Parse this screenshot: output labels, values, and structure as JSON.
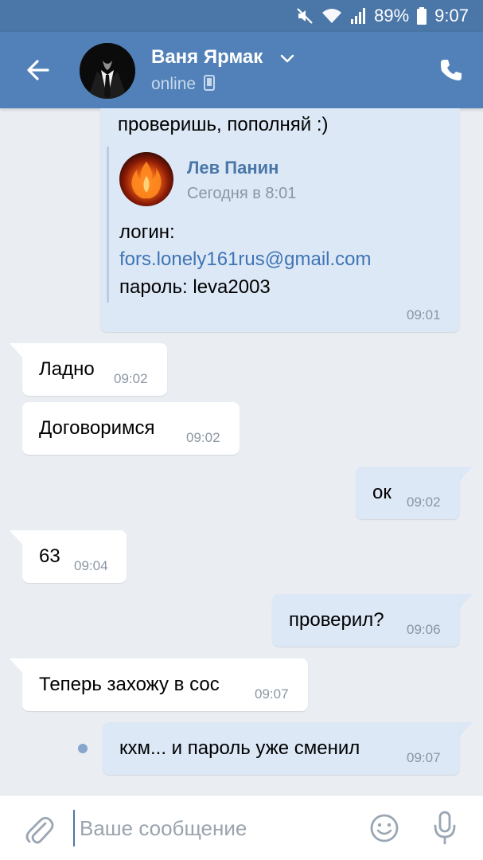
{
  "status_bar": {
    "battery_percent": "89%",
    "time": "9:07",
    "icons": [
      "mute-icon",
      "wifi-icon",
      "signal-icon",
      "battery-icon"
    ]
  },
  "header": {
    "contact_name": "Ваня Ярмак",
    "presence": "online",
    "icons": [
      "back-arrow-icon",
      "chevron-down-icon",
      "mobile-device-icon",
      "phone-icon"
    ]
  },
  "forwarded_message": {
    "text_top": "проверишь, пополняй :)",
    "author": "Лев Панин",
    "date": "Сегодня в 8:01",
    "line1": "логин:",
    "email": "fors.lonely161rus@gmail.com",
    "line3": "пароль: leva2003",
    "time": "09:01"
  },
  "messages": [
    {
      "text": "Ладно",
      "time": "09:02",
      "direction": "in"
    },
    {
      "text": "Договоримся",
      "time": "09:02",
      "direction": "in"
    },
    {
      "text": "ок",
      "time": "09:02",
      "direction": "out"
    },
    {
      "text": "63",
      "time": "09:04",
      "direction": "in"
    },
    {
      "text": "проверил?",
      "time": "09:06",
      "direction": "out"
    },
    {
      "text": "Теперь захожу в сос",
      "time": "09:07",
      "direction": "in"
    },
    {
      "text": "кхм... и пароль уже сменил",
      "time": "09:07",
      "direction": "out",
      "unread": true
    }
  ],
  "input": {
    "placeholder": "Ваше сообщение",
    "value": ""
  },
  "colors": {
    "header": "#5181b8",
    "status_bar": "#4a76a8",
    "chat_background": "#eaeef3",
    "outgoing_bubble": "#dce8f6",
    "incoming_bubble": "#ffffff",
    "link": "#3f74b5"
  }
}
